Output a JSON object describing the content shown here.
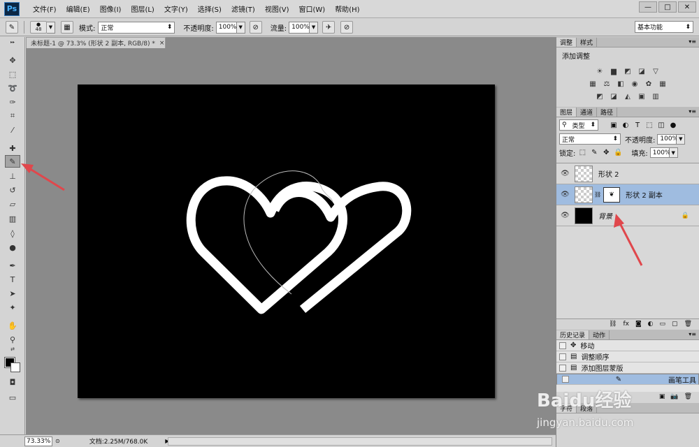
{
  "app": {
    "logo": "Ps"
  },
  "menu": [
    "文件(F)",
    "编辑(E)",
    "图像(I)",
    "图层(L)",
    "文字(Y)",
    "选择(S)",
    "滤镜(T)",
    "视图(V)",
    "窗口(W)",
    "帮助(H)"
  ],
  "window_controls": {
    "minimize": "—",
    "restore": "□",
    "close": "✕"
  },
  "options": {
    "brush_size": "48",
    "mode_label": "模式:",
    "mode_value": "正常",
    "opacity_label": "不透明度:",
    "opacity_value": "100%",
    "flow_label": "流量:",
    "flow_value": "100%",
    "workspace": "基本功能"
  },
  "document": {
    "tab_title": "未标题-1 @ 73.3% (形状 2 副本, RGB/8) *",
    "tab_close": "×",
    "canvas_color": "#000000",
    "stroke_color": "#ffffff"
  },
  "status": {
    "zoom": "73.33%",
    "doc_info": "文档:2.25M/768.0K",
    "arrow": "▶"
  },
  "adjustments": {
    "tabs": [
      "调整",
      "样式"
    ],
    "title": "添加调整"
  },
  "layers_panel": {
    "tabs": [
      "图层",
      "通道",
      "路径"
    ],
    "filter": "类型",
    "blend": "正常",
    "opacity_label": "不透明度:",
    "opacity_value": "100%",
    "lock_label": "锁定:",
    "fill_label": "填充:",
    "fill_value": "100%",
    "layers": [
      {
        "name": "形状 2"
      },
      {
        "name": "形状 2 副本"
      },
      {
        "name": "背景"
      }
    ]
  },
  "history_panel": {
    "tabs": [
      "历史记录",
      "动作"
    ],
    "items": [
      "移动",
      "调整顺序",
      "添加图层蒙版",
      "画笔工具"
    ]
  },
  "bottom_tabs": [
    "字符",
    "段落"
  ],
  "watermark": {
    "brand": "Baidu经验",
    "url": "jingyan.baidu.com"
  },
  "accent_color": "#e0474c"
}
